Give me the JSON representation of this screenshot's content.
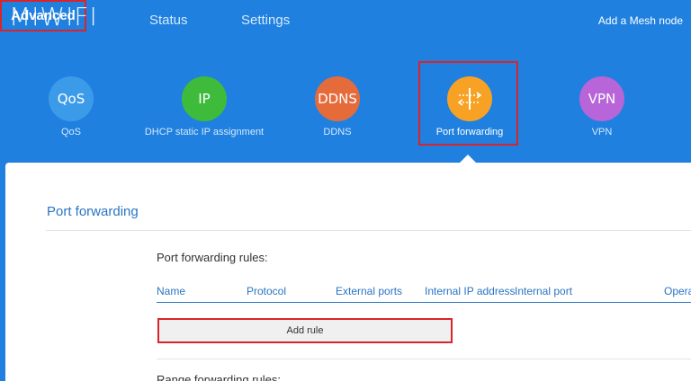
{
  "app": {
    "logo": "MIWIFI"
  },
  "nav": {
    "status": "Status",
    "settings": "Settings",
    "advanced": "Advanced",
    "mesh": "Add a Mesh node"
  },
  "features": {
    "qos": {
      "icon_text": "QoS",
      "label": "QoS",
      "color": "#3c9be8"
    },
    "ip": {
      "icon_text": "IP",
      "label": "DHCP static IP assignment",
      "color": "#3fbb3b"
    },
    "ddns": {
      "icon_text": "DDNS",
      "label": "DDNS",
      "color": "#e66b3a"
    },
    "port_forwarding": {
      "icon": "port-forwarding-icon",
      "label": "Port forwarding",
      "color": "#f7a224"
    },
    "vpn": {
      "icon_text": "VPN",
      "label": "VPN",
      "color": "#b765d8"
    }
  },
  "panel": {
    "title": "Port forwarding",
    "rules_label": "Port forwarding rules:",
    "columns": [
      "Name",
      "Protocol",
      "External ports",
      "Internal IP address",
      "Internal port",
      "Opera"
    ],
    "add_rule": "Add rule",
    "range_label": "Range forwarding rules:"
  },
  "colors": {
    "background": "#1f80e0",
    "accent": "#2a74c4",
    "highlight": "#d9242b"
  }
}
